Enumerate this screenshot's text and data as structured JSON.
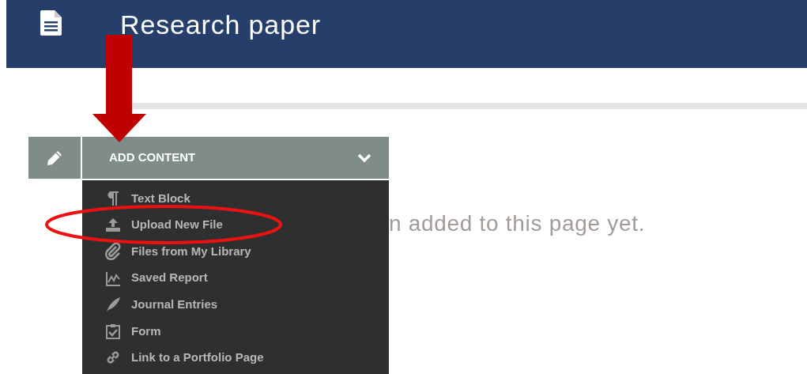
{
  "header": {
    "title": "Research paper"
  },
  "toolbar": {
    "label": "ADD CONTENT",
    "expanded": true
  },
  "menu": [
    {
      "kind": "paragraph",
      "label": "Text Block",
      "circled": false
    },
    {
      "kind": "upload",
      "label": "Upload New File",
      "circled": true
    },
    {
      "kind": "paperclip",
      "label": "Files from My Library",
      "circled": false
    },
    {
      "kind": "chart",
      "label": "Saved Report",
      "circled": false
    },
    {
      "kind": "feather",
      "label": "Journal Entries",
      "circled": false
    },
    {
      "kind": "form",
      "label": "Form",
      "circled": false
    },
    {
      "kind": "link",
      "label": "Link to a Portfolio Page",
      "circled": false
    }
  ],
  "empty_message": "n added to this page yet.",
  "annotations": {
    "arrow": true
  }
}
